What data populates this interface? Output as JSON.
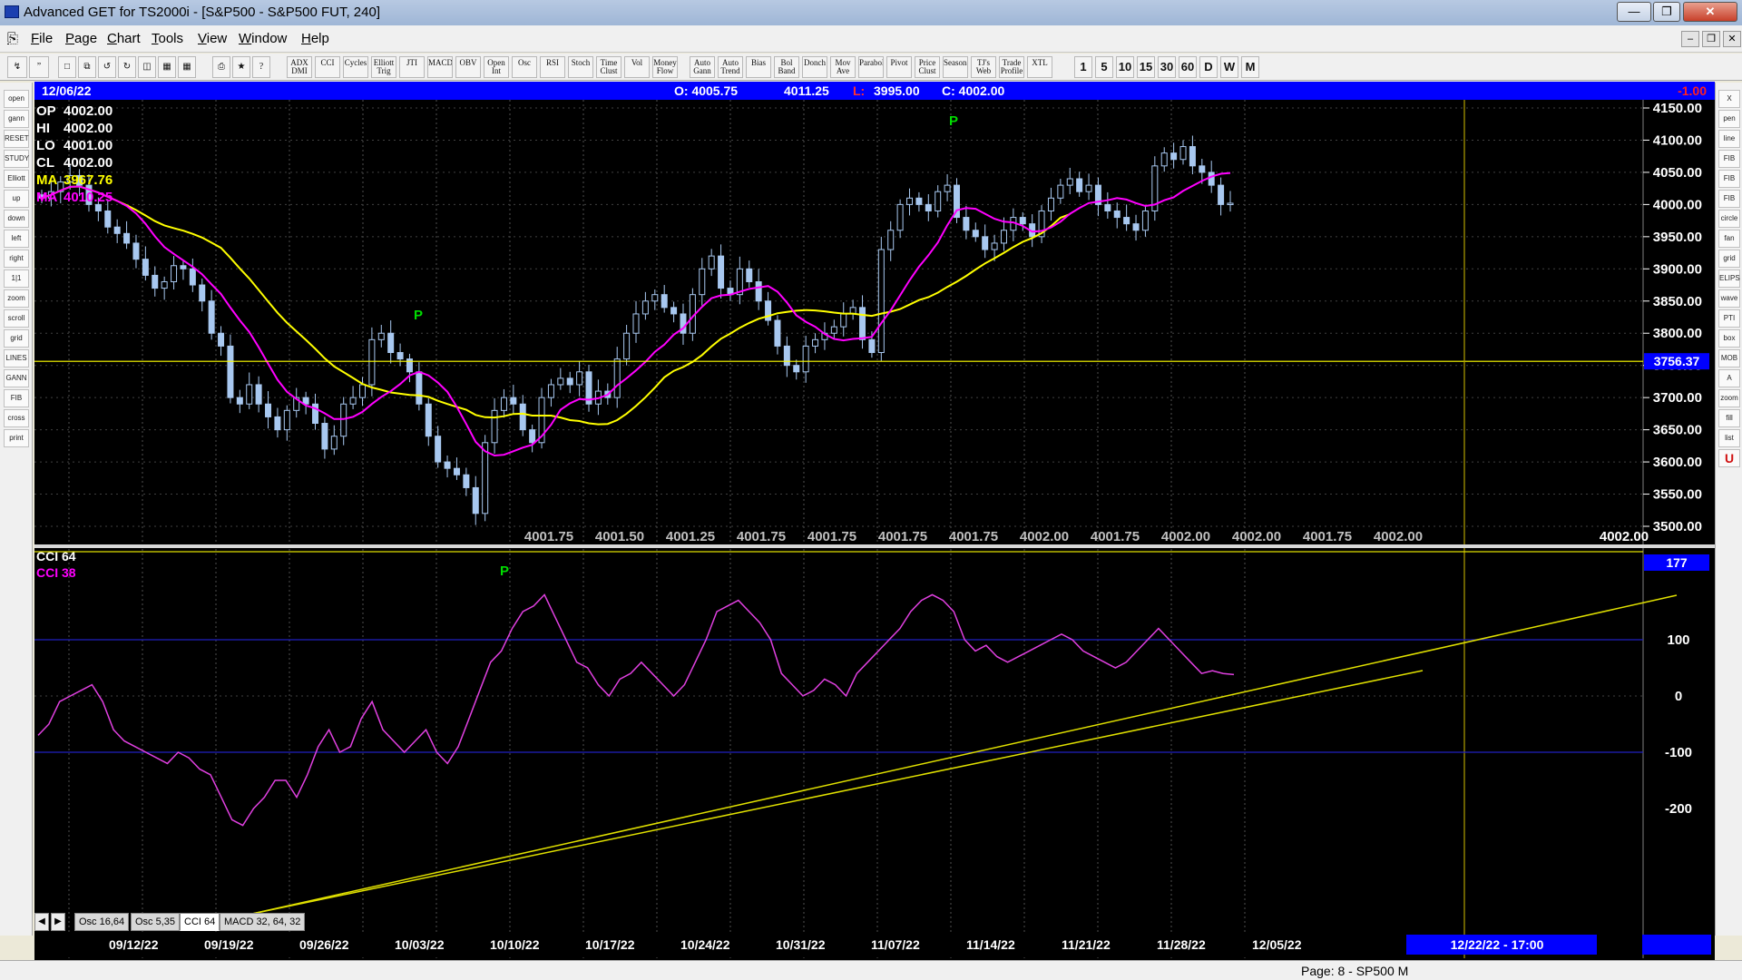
{
  "window": {
    "title": "Advanced GET for TS2000i - [S&P500 - S&P500 FUT, 240]"
  },
  "menu": [
    "File",
    "Page",
    "Chart",
    "Tools",
    "View",
    "Window",
    "Help"
  ],
  "toolbar": {
    "study_buttons": [
      "ADX DMI",
      "CCI",
      "Cycles",
      "Elliott Trig",
      "JTI",
      "MACD",
      "OBV",
      "Open Int",
      "Osc",
      "RSI",
      "Stoch",
      "Time Clust",
      "Vol",
      "Money Flow",
      "Auto Gann",
      "Auto Trend",
      "Bias",
      "Bol Band",
      "Donch",
      "Mov Ave",
      "Parabolic",
      "Pivot",
      "Price Clust",
      "Seasonals",
      "TJ's Web",
      "Trade Profile",
      "XTL"
    ],
    "intervals": [
      "1",
      "5",
      "10",
      "15",
      "30",
      "60",
      "D",
      "W",
      "M"
    ]
  },
  "left_toolbar": [
    "open",
    "gann",
    "RESET",
    "STUDY",
    "Elliott",
    "up",
    "down",
    "left",
    "right",
    "1|1",
    "zoom",
    "scroll",
    "grid",
    "LINES",
    "GANN",
    "FIB",
    "cross",
    "print"
  ],
  "right_toolbar": [
    "X",
    "pen",
    "line",
    "FIB RET",
    "FIB EXT",
    "FIB TIME",
    "circle",
    "fan",
    "grid",
    "ELIPS",
    "wave",
    "PTI",
    "box",
    "MOB",
    "A",
    "zoom",
    "fill",
    "list",
    "U"
  ],
  "header": {
    "date": "12/06/22",
    "open": "O: 4005.75",
    "high": "4011.25",
    "low_label": "L:",
    "low": "3995.00",
    "close": "C: 4002.00",
    "change": "-1.00"
  },
  "info_box": [
    {
      "label": "OP",
      "value": "4002.00",
      "color": "#ffffff"
    },
    {
      "label": "HI",
      "value": "4002.00",
      "color": "#ffffff"
    },
    {
      "label": "LO",
      "value": "4001.00",
      "color": "#ffffff"
    },
    {
      "label": "CL",
      "value": "4002.00",
      "color": "#ffffff"
    },
    {
      "label": "MA",
      "value": "3967.76",
      "color": "#ffff00"
    },
    {
      "label": "MA",
      "value": "4010.25",
      "color": "#ff00ff"
    }
  ],
  "price_axis": [
    "4150.00",
    "4100.00",
    "4050.00",
    "4000.00",
    "3950.00",
    "3900.00",
    "3850.00",
    "3800.00",
    "3750.00",
    "3700.00",
    "3650.00",
    "3600.00",
    "3550.00",
    "3500.00"
  ],
  "hline_label": "3756.37",
  "footer_values": [
    "4001.75",
    "4001.50",
    "4001.25",
    "4001.75",
    "4001.75",
    "4001.75",
    "4001.75",
    "4002.00",
    "4001.75",
    "4002.00",
    "4002.00",
    "4001.75",
    "4002.00"
  ],
  "footer_last": "4002.00",
  "pivot_label": "P",
  "cci": {
    "title": "CCI 64",
    "value_label": "CCI  38",
    "current": "177",
    "axis": [
      "100",
      "0",
      "-100",
      "-200"
    ]
  },
  "tabs": [
    "Osc 16,64",
    "Osc 5,35",
    "CCI 64",
    "MACD 32, 64, 32"
  ],
  "dates": [
    "09/12/22",
    "09/19/22",
    "09/26/22",
    "10/03/22",
    "10/10/22",
    "10/17/22",
    "10/24/22",
    "10/31/22",
    "11/07/22",
    "11/14/22",
    "11/21/22",
    "11/28/22",
    "12/05/22"
  ],
  "cursor_time": "12/22/22 - 17:00",
  "status": "Page: 8 - SP500 M",
  "colors": {
    "bg": "#000000",
    "candle": "#a8c8f0",
    "ma_fast": "#ffff00",
    "ma_slow": "#ff00ff",
    "header": "#0000ff",
    "pivot": "#00dd00",
    "grid": "#606060",
    "cci": "#e040e0"
  },
  "chart_data": [
    {
      "type": "candlestick",
      "title": "S&P500 - S&P500 FUT, 240",
      "x_range": [
        "09/07/22",
        "12/06/22"
      ],
      "ylim": [
        3490,
        4170
      ],
      "y_ticks": [
        3500,
        3550,
        3600,
        3650,
        3700,
        3750,
        3800,
        3850,
        3900,
        3950,
        4000,
        4050,
        4100,
        4150
      ],
      "last_bar": {
        "date": "12/06/22",
        "open": 4005.75,
        "high": 4011.25,
        "low": 3995.0,
        "close": 4002.0
      },
      "horizontal_line": 3756.37,
      "series": [
        {
          "name": "MA",
          "last": 3967.76
        },
        {
          "name": "MA",
          "last": 4010.25
        }
      ],
      "closes": [
        4010,
        4020,
        4035,
        4045,
        4030,
        4000,
        3990,
        3965,
        3955,
        3940,
        3915,
        3890,
        3870,
        3880,
        3905,
        3900,
        3875,
        3850,
        3800,
        3780,
        3700,
        3690,
        3720,
        3690,
        3670,
        3650,
        3680,
        3700,
        3690,
        3660,
        3620,
        3640,
        3690,
        3700,
        3720,
        3790,
        3800,
        3770,
        3760,
        3740,
        3690,
        3640,
        3600,
        3590,
        3580,
        3560,
        3520,
        3630,
        3680,
        3700,
        3690,
        3650,
        3630,
        3700,
        3720,
        3730,
        3720,
        3740,
        3690,
        3710,
        3700,
        3760,
        3800,
        3830,
        3850,
        3860,
        3840,
        3830,
        3800,
        3860,
        3900,
        3920,
        3870,
        3860,
        3900,
        3880,
        3850,
        3820,
        3780,
        3750,
        3740,
        3780,
        3790,
        3800,
        3810,
        3830,
        3840,
        3790,
        3770,
        3930,
        3960,
        4000,
        4010,
        4000,
        3990,
        4020,
        4030,
        3980,
        3960,
        3950,
        3930,
        3940,
        3960,
        3980,
        3970,
        3950,
        3990,
        4010,
        4030,
        4040,
        4020,
        4030,
        4000,
        3990,
        3980,
        3970,
        3960,
        3990,
        4060,
        4080,
        4070,
        4090,
        4060,
        4050,
        4030,
        4000,
        4002
      ]
    },
    {
      "type": "line",
      "title": "CCI 64",
      "ylim": [
        -250,
        200
      ],
      "y_ticks": [
        100,
        0,
        -100,
        -200
      ],
      "reference_lines": [
        100,
        -100
      ],
      "series": [
        {
          "name": "CCI 64",
          "values": [
            -70,
            -50,
            -10,
            0,
            10,
            20,
            -10,
            -60,
            -80,
            -90,
            -100,
            -110,
            -120,
            -100,
            -110,
            -130,
            -140,
            -180,
            -220,
            -230,
            -200,
            -180,
            -150,
            -150,
            -180,
            -140,
            -90,
            -60,
            -100,
            -90,
            -40,
            -10,
            -60,
            -80,
            -100,
            -80,
            -60,
            -100,
            -120,
            -90,
            -40,
            10,
            60,
            80,
            120,
            150,
            160,
            180,
            140,
            100,
            60,
            50,
            20,
            0,
            30,
            40,
            60,
            40,
            20,
            0,
            20,
            60,
            100,
            150,
            160,
            170,
            150,
            130,
            100,
            40,
            20,
            0,
            10,
            30,
            20,
            0,
            40,
            60,
            80,
            100,
            120,
            150,
            170,
            180,
            170,
            150,
            100,
            80,
            90,
            70,
            60,
            70,
            80,
            90,
            100,
            110,
            100,
            80,
            70,
            60,
            50,
            60,
            80,
            100,
            120,
            100,
            80,
            60,
            40,
            45,
            40,
            38
          ]
        }
      ]
    }
  ]
}
